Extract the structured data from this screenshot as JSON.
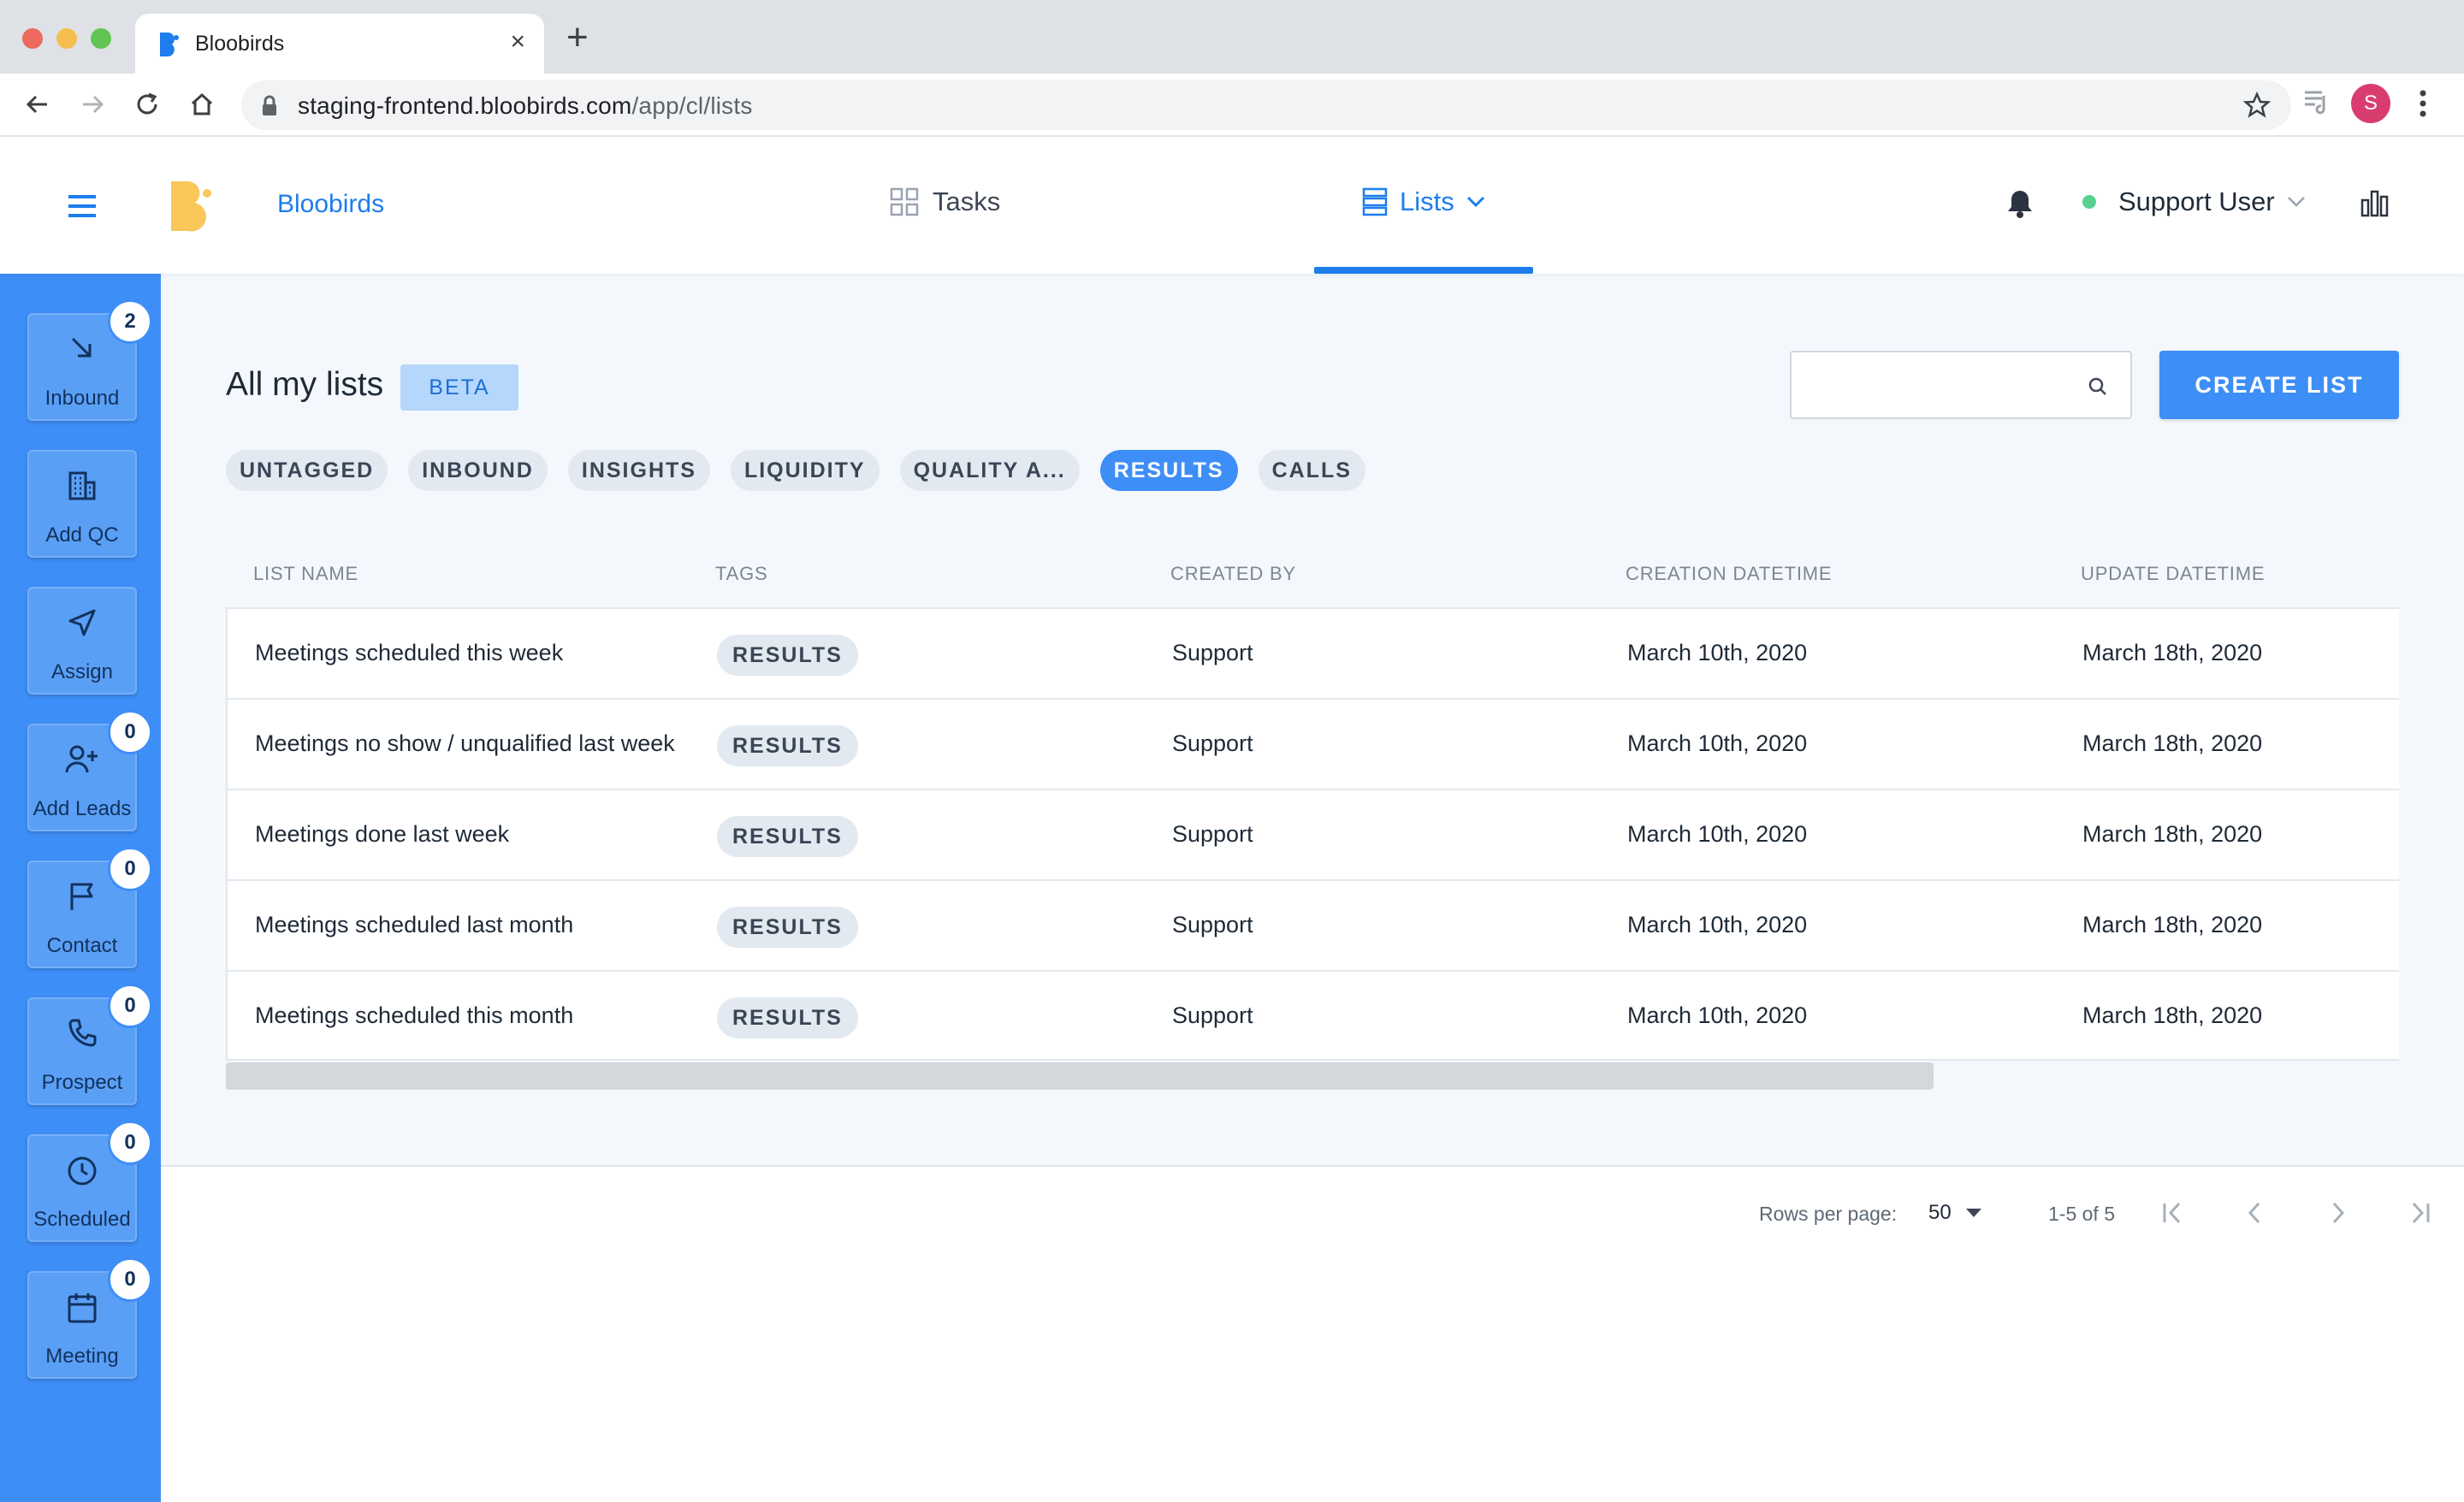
{
  "browser": {
    "tab_title": "Bloobirds",
    "new_tab_symbol": "+",
    "close_symbol": "×",
    "url_host": "staging-frontend.bloobirds.com",
    "url_path": "/app/cl/lists",
    "profile_initial": "S"
  },
  "header": {
    "brand": "Bloobirds",
    "nav": {
      "tasks": "Tasks",
      "lists": "Lists"
    },
    "user_name": "Support User",
    "status_color": "#5bd190",
    "accent_color": "#1d7ded"
  },
  "sidebar": {
    "items": [
      {
        "label": "Inbound",
        "icon": "arrow-down-right-icon",
        "badge": "2"
      },
      {
        "label": "Add QC",
        "icon": "building-icon",
        "badge": null
      },
      {
        "label": "Assign",
        "icon": "send-icon",
        "badge": null
      },
      {
        "label": "Add Leads",
        "icon": "user-plus-icon",
        "badge": "0"
      },
      {
        "label": "Contact",
        "icon": "flag-icon",
        "badge": "0"
      },
      {
        "label": "Prospect",
        "icon": "phone-icon",
        "badge": "0"
      },
      {
        "label": "Scheduled",
        "icon": "clock-icon",
        "badge": "0"
      },
      {
        "label": "Meeting",
        "icon": "calendar-icon",
        "badge": "0"
      }
    ]
  },
  "page": {
    "title": "All my lists",
    "beta_label": "BETA",
    "search_placeholder": "",
    "create_button": "CREATE LIST"
  },
  "filters": {
    "chips": [
      "UNTAGGED",
      "INBOUND",
      "INSIGHTS",
      "LIQUIDITY",
      "QUALITY A...",
      "RESULTS",
      "CALLS"
    ],
    "active": "RESULTS"
  },
  "table": {
    "columns": [
      "LIST NAME",
      "TAGS",
      "CREATED BY",
      "CREATION DATETIME",
      "UPDATE DATETIME"
    ],
    "rows": [
      {
        "name": "Meetings scheduled this week",
        "tag": "RESULTS",
        "created_by": "Support",
        "created": "March 10th, 2020",
        "updated": "March 18th, 2020"
      },
      {
        "name": "Meetings no show / unqualified last week",
        "tag": "RESULTS",
        "created_by": "Support",
        "created": "March 10th, 2020",
        "updated": "March 18th, 2020"
      },
      {
        "name": "Meetings done last week",
        "tag": "RESULTS",
        "created_by": "Support",
        "created": "March 10th, 2020",
        "updated": "March 18th, 2020"
      },
      {
        "name": "Meetings scheduled last month",
        "tag": "RESULTS",
        "created_by": "Support",
        "created": "March 10th, 2020",
        "updated": "March 18th, 2020"
      },
      {
        "name": "Meetings scheduled this month",
        "tag": "RESULTS",
        "created_by": "Support",
        "created": "March 10th, 2020",
        "updated": "March 18th, 2020"
      }
    ]
  },
  "pagination": {
    "rows_per_page_label": "Rows per page:",
    "rows_per_page": "50",
    "range": "1-5 of 5"
  }
}
